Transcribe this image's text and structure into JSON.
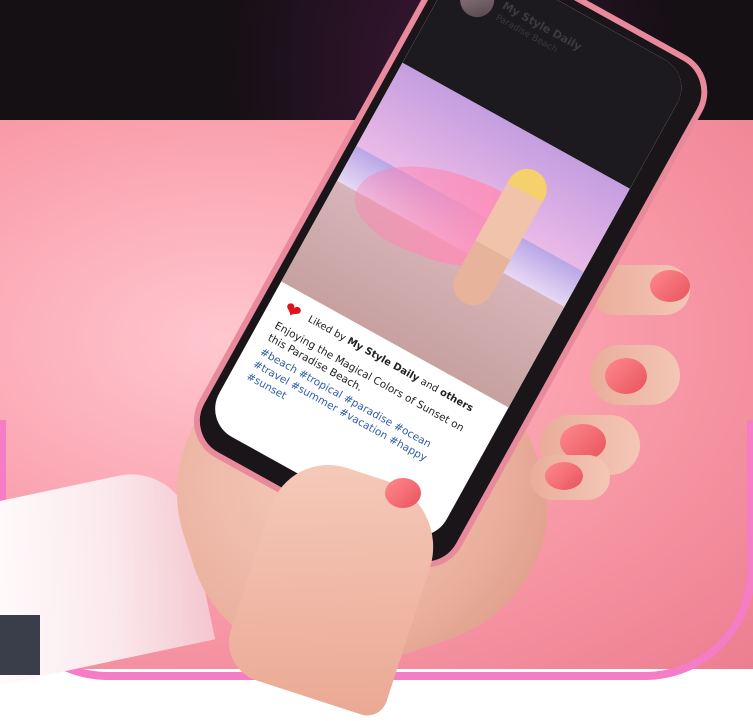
{
  "post": {
    "account_name": "My Style Daily",
    "location": "Paradise Beach",
    "liked_prefix": "Liked by",
    "liked_by": "My Style Daily",
    "liked_and": "and",
    "liked_others": "others",
    "description": "Enjoying the Magical Colors of Sunset on this Paradise Beach.",
    "hashtags": "#beach #tropical #paradise #ocean #travel #summer #vacation #happy #sunset"
  },
  "icons": {
    "like": "heart-icon",
    "avatar": "avatar"
  },
  "colors": {
    "like": "#e0121e",
    "hashtag": "#2f5da8",
    "frame_accent": "#f47dc6",
    "background": "#f99aa8"
  }
}
